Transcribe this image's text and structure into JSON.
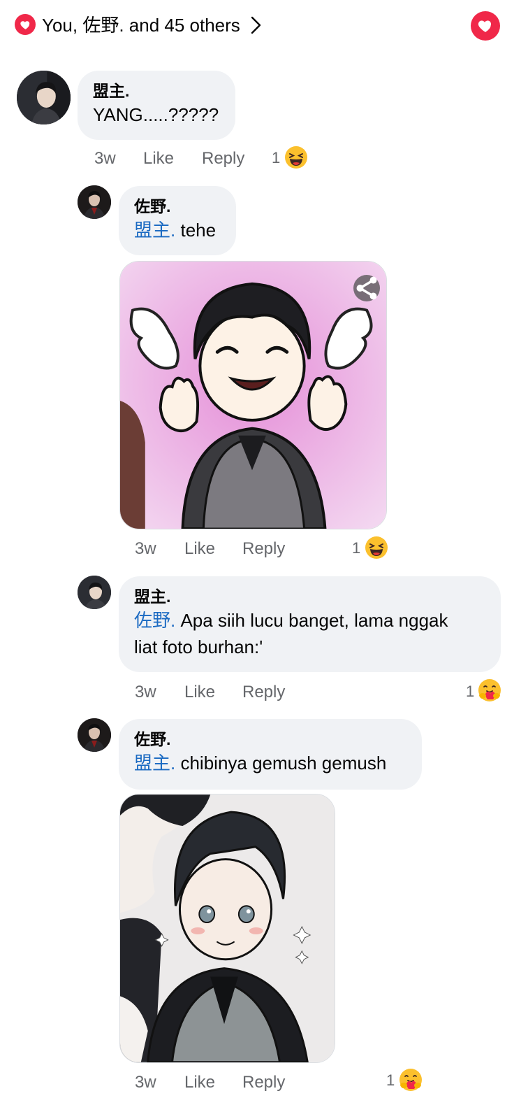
{
  "header": {
    "reactions_summary": "You, 佐野. and 45 others",
    "reaction_icon": "heart-icon",
    "accent_color": "#f02849"
  },
  "comments": [
    {
      "author": "盟主.",
      "mention": "",
      "text": "YANG.....?????",
      "time": "3w",
      "like_label": "Like",
      "reply_label": "Reply",
      "reaction_count": "1",
      "reaction_icon": "haha-icon"
    },
    {
      "author": "佐野.",
      "mention": "盟主.",
      "text": "tehe",
      "time": "3w",
      "like_label": "Like",
      "reply_label": "Reply",
      "reaction_count": "1",
      "reaction_icon": "haha-icon",
      "image": "smiling-chibi-with-wings"
    },
    {
      "author": "盟主.",
      "mention": "佐野.",
      "text_line1": "Apa siih lucu banget, lama nggak",
      "text_line2": "liat foto burhan:'",
      "time": "3w",
      "like_label": "Like",
      "reply_label": "Reply",
      "reaction_count": "1",
      "reaction_icon": "care-icon"
    },
    {
      "author": "佐野.",
      "mention": "盟主.",
      "text": "chibinya gemush gemush",
      "time": "3w",
      "like_label": "Like",
      "reply_label": "Reply",
      "reaction_count": "1",
      "reaction_icon": "care-icon",
      "image": "chibi-in-vest"
    }
  ]
}
